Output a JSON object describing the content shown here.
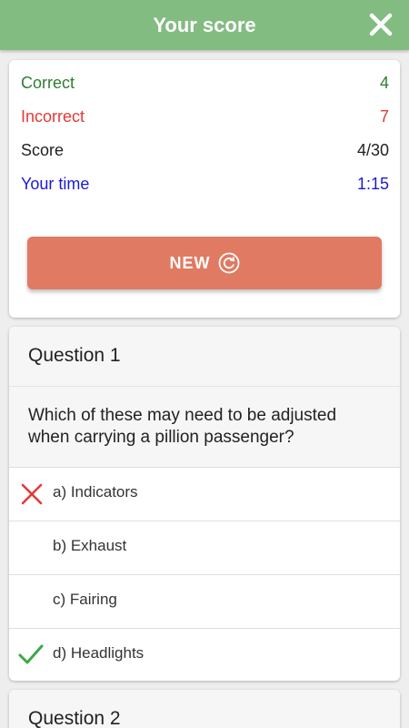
{
  "header": {
    "title": "Your score",
    "close_icon": "close-icon"
  },
  "colors": {
    "header": "#82bc81",
    "correct": "#2e7d32",
    "incorrect": "#e53935",
    "time": "#1a1ad6",
    "new_button": "#e07a62"
  },
  "stats": {
    "correct_label": "Correct",
    "correct_value": "4",
    "incorrect_label": "Incorrect",
    "incorrect_value": "7",
    "score_label": "Score",
    "score_value": "4/30",
    "time_label": "Your time",
    "time_value": "1:15"
  },
  "new_button": {
    "label": "NEW",
    "icon": "refresh-icon"
  },
  "questions": [
    {
      "title": "Question 1",
      "text": "Which of these may need to be adjusted when carrying a pillion passenger?",
      "answers": [
        {
          "label": "a) Indicators",
          "mark": "cross-icon"
        },
        {
          "label": "b) Exhaust",
          "mark": ""
        },
        {
          "label": "c) Fairing",
          "mark": ""
        },
        {
          "label": "d) Headlights",
          "mark": "check-icon"
        }
      ]
    },
    {
      "title": "Question 2"
    }
  ]
}
